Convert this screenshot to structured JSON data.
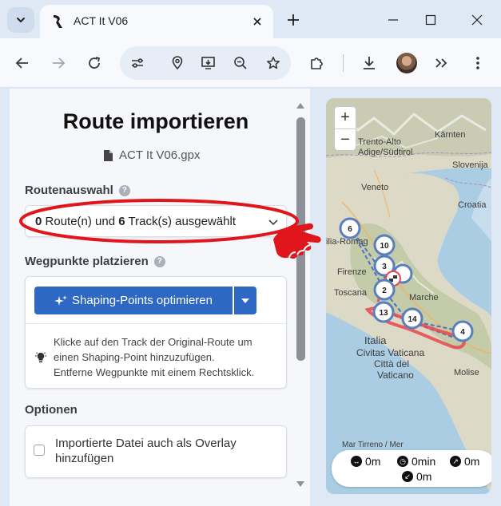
{
  "browser": {
    "tab_title": "ACT It V06",
    "tab_close": "×",
    "new_tab": "+"
  },
  "panel": {
    "title": "Route importieren",
    "filename": "ACT It V06.gpx",
    "route_section": {
      "label": "Routenauswahl",
      "help": "?",
      "route_count": "0",
      "route_text": "Route(n) und",
      "track_count": "6",
      "track_text": "Track(s) ausgewählt"
    },
    "waypoint_section": {
      "label": "Wegpunkte platzieren",
      "help": "?",
      "button_label": "Shaping-Points optimieren",
      "info_line1": "Klicke auf den Track der Original-Route um",
      "info_line2": "einen Shaping-Point hinzuzufügen.",
      "info_line3": "Entferne Wegpunkte mit einem Rechtsklick."
    },
    "options_section": {
      "label": "Optionen",
      "overlay_label": "Importierte Datei auch als Overlay hinzufügen",
      "overlay_checked": false
    }
  },
  "map": {
    "zoom_in": "+",
    "zoom_out": "−",
    "labels": [
      "Trento-Alto",
      "Adige/Südtirol",
      "Kärnten",
      "Slovenija",
      "Veneto",
      "Croatia",
      "ilia-Romag",
      "Firenze",
      "Toscana",
      "Marche",
      "Italia",
      "Civitas Vaticana",
      "Città del",
      "Vaticano",
      "Molise",
      "Mar Tirreno / Mer"
    ],
    "clusters": [
      "6",
      "10",
      "3",
      "2",
      "13",
      "14",
      "4"
    ],
    "colors": {
      "track": "#e8474c",
      "cluster_border": "#5a7fc0",
      "route_dash": "#4a73c4"
    },
    "stats": {
      "distance_1": "0m",
      "duration": "0min",
      "ascent": "0m",
      "descent": "0m"
    }
  },
  "colors": {
    "accent": "#2d68c4",
    "annotation": "#e0161c"
  }
}
